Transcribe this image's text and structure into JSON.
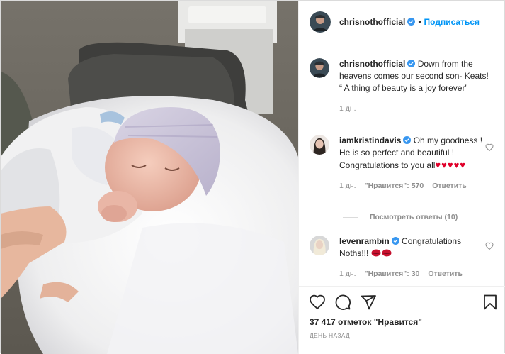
{
  "post": {
    "author": "chrisnothofficial",
    "follow_label": "Подписаться",
    "dot": "•",
    "image_alt": "Newborn baby sleeping in knit hat"
  },
  "caption": {
    "author": "chrisnothofficial",
    "text": "Down from the heavens comes our second son- Keats! “ A thing of beauty is a joy forever”",
    "time": "1 дн."
  },
  "comments": [
    {
      "author": "iamkristindavis",
      "text": "Oh my goodness ! He is so perfect and beautiful ! Congratulations to you all",
      "emoji": "♥♥♥♥♥",
      "time": "1 дн.",
      "likes": "\"Нравится\": 570",
      "reply": "Ответить",
      "view_replies": "Посмотреть ответы (10)"
    },
    {
      "author": "levenrambin",
      "text": "Congratulations Noths!!!",
      "time": "1 дн.",
      "likes": "\"Нравится\": 30",
      "reply": "Ответить"
    }
  ],
  "footer": {
    "likes_count": "37 417 отметок \"Нравится\"",
    "date": "ДЕНЬ НАЗАД"
  },
  "icons": {
    "like": "heart-icon",
    "comment": "comment-icon",
    "share": "share-icon",
    "save": "bookmark-icon",
    "verified": "verified-badge-icon"
  },
  "colors": {
    "accent": "#0095f6",
    "text": "#262626",
    "muted": "#8e8e8e",
    "heart": "#e0002a"
  }
}
